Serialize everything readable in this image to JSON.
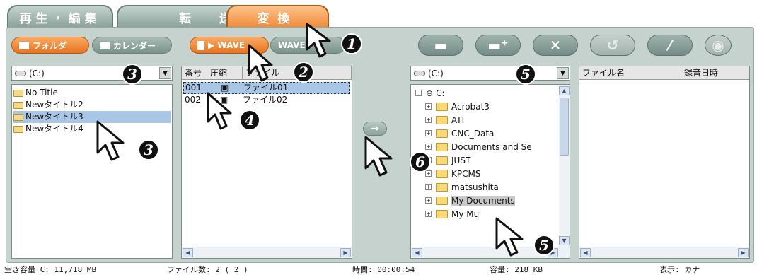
{
  "tabs": [
    {
      "label": "再生・編集"
    },
    {
      "label": "転送"
    },
    {
      "label": "変換"
    }
  ],
  "left_toolbar": {
    "folder_btn": "フォルダ",
    "calendar_btn": "カレンダー"
  },
  "mid_toolbar": {
    "wave_btn": "▶ WAVE",
    "wave_btn2": "WAVE→"
  },
  "right_toolbar": {
    "icons": [
      "folder-d-icon",
      "new-folder-icon",
      "delete-icon",
      "undo-icon",
      "rename-icon",
      "disc-icon"
    ]
  },
  "left_panel": {
    "drive": "(C:)",
    "folders": [
      "No Title",
      "Newタイトル2",
      "Newタイトル3",
      "Newタイトル4"
    ],
    "selected_index": 2
  },
  "file_panel": {
    "headers": [
      "番号",
      "圧縮",
      "ファイル"
    ],
    "rows": [
      {
        "num": "001",
        "name": "ファイル01",
        "selected": true
      },
      {
        "num": "002",
        "name": "ファイル02",
        "selected": false
      }
    ]
  },
  "transfer_button": "→",
  "tree_panel": {
    "drive": "(C:)",
    "root": "C:",
    "items": [
      "Acrobat3",
      "ATI",
      "CNC_Data",
      "Documents and Se",
      "JUST",
      "KPCMS",
      "matsushita",
      "My Documents",
      "My Mu"
    ],
    "highlighted": "My Documents"
  },
  "dest_panel": {
    "headers": [
      "ファイル名",
      "録音日時"
    ]
  },
  "status": {
    "free_space": "空き容量 C: 11,718 MB",
    "file_count": "ファイル数: 2 ( 2 )",
    "time": "時間: 00:00:54",
    "capacity": "容量: 218 KB",
    "display": "表示: カナ"
  },
  "markers": [
    "1",
    "2",
    "3",
    "3",
    "4",
    "5",
    "5",
    "6"
  ]
}
